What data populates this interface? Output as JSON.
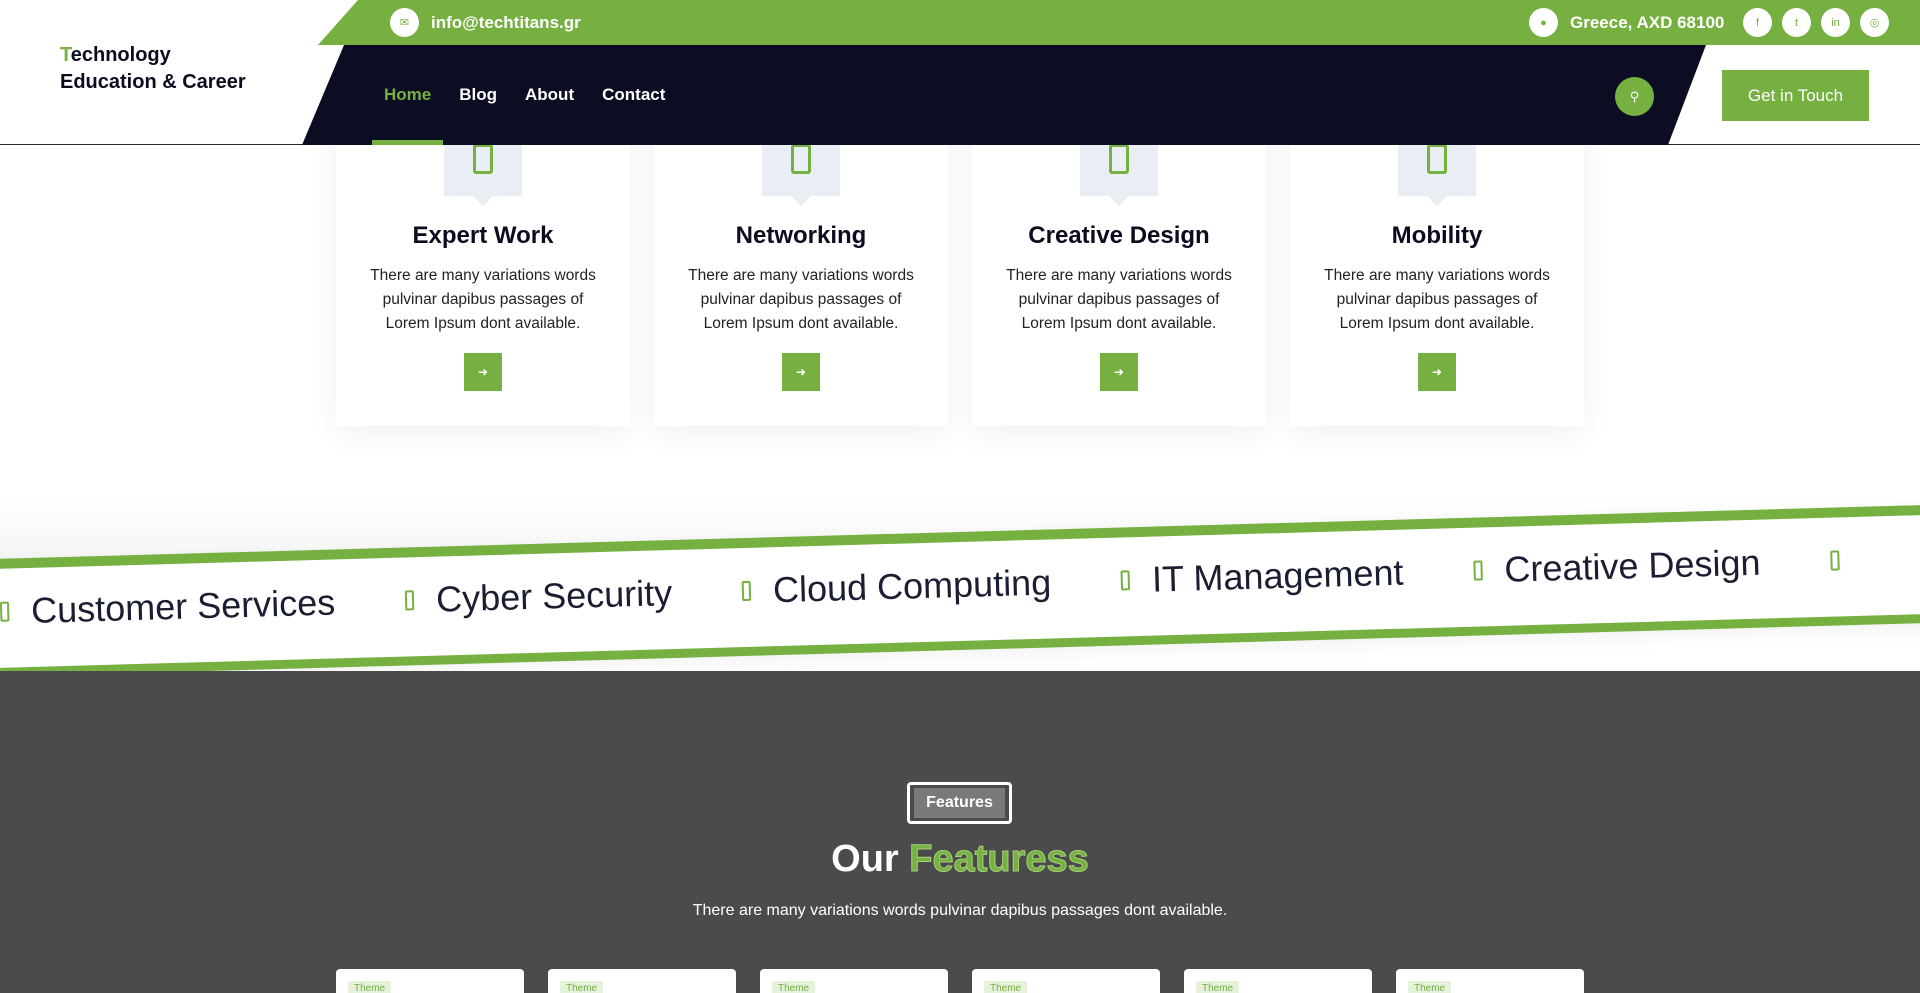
{
  "brand": {
    "logo_first_letter": "T",
    "logo_line1_rest": "echnology",
    "logo_line2": "Education & Career",
    "accent_color": "#76b041",
    "navy_color": "#0c0d22"
  },
  "topbar": {
    "email": "info@techtitans.gr",
    "location": "Greece, AXD 68100",
    "email_icon": "envelope-icon",
    "location_icon": "map-pin-icon",
    "social_icons": [
      "facebook-icon",
      "twitter-icon",
      "linkedin-icon",
      "instagram-icon"
    ]
  },
  "nav": {
    "items": [
      {
        "label": "Home",
        "active": true
      },
      {
        "label": "Blog",
        "active": false
      },
      {
        "label": "About",
        "active": false
      },
      {
        "label": "Contact",
        "active": false
      }
    ],
    "search_icon": "search-icon",
    "cta_label": "Get in Touch"
  },
  "service_cards": [
    {
      "title": "Expert Work",
      "text": "There are many variations words pulvinar dapibus passages of Lorem Ipsum dont available.",
      "icon": "service-icon"
    },
    {
      "title": "Networking",
      "text": "There are many variations words pulvinar dapibus passages of Lorem Ipsum dont available.",
      "icon": "service-icon"
    },
    {
      "title": "Creative Design",
      "text": "There are many variations words pulvinar dapibus passages of Lorem Ipsum dont available.",
      "icon": "service-icon"
    },
    {
      "title": "Mobility",
      "text": "There are many variations words pulvinar dapibus passages of Lorem Ipsum dont available.",
      "icon": "service-icon"
    }
  ],
  "marquee": {
    "items": [
      "Customer Services",
      "Cyber Security",
      "Cloud Computing",
      "IT Management",
      "Creative Design"
    ]
  },
  "features": {
    "tag": "Features",
    "title_plain": "Our",
    "title_accent": "Featuress",
    "subtitle": "There are many variations words pulvinar dapibus passages dont available.",
    "card_badges": [
      "Theme",
      "Theme",
      "Theme",
      "Theme",
      "Theme",
      "Theme"
    ]
  }
}
